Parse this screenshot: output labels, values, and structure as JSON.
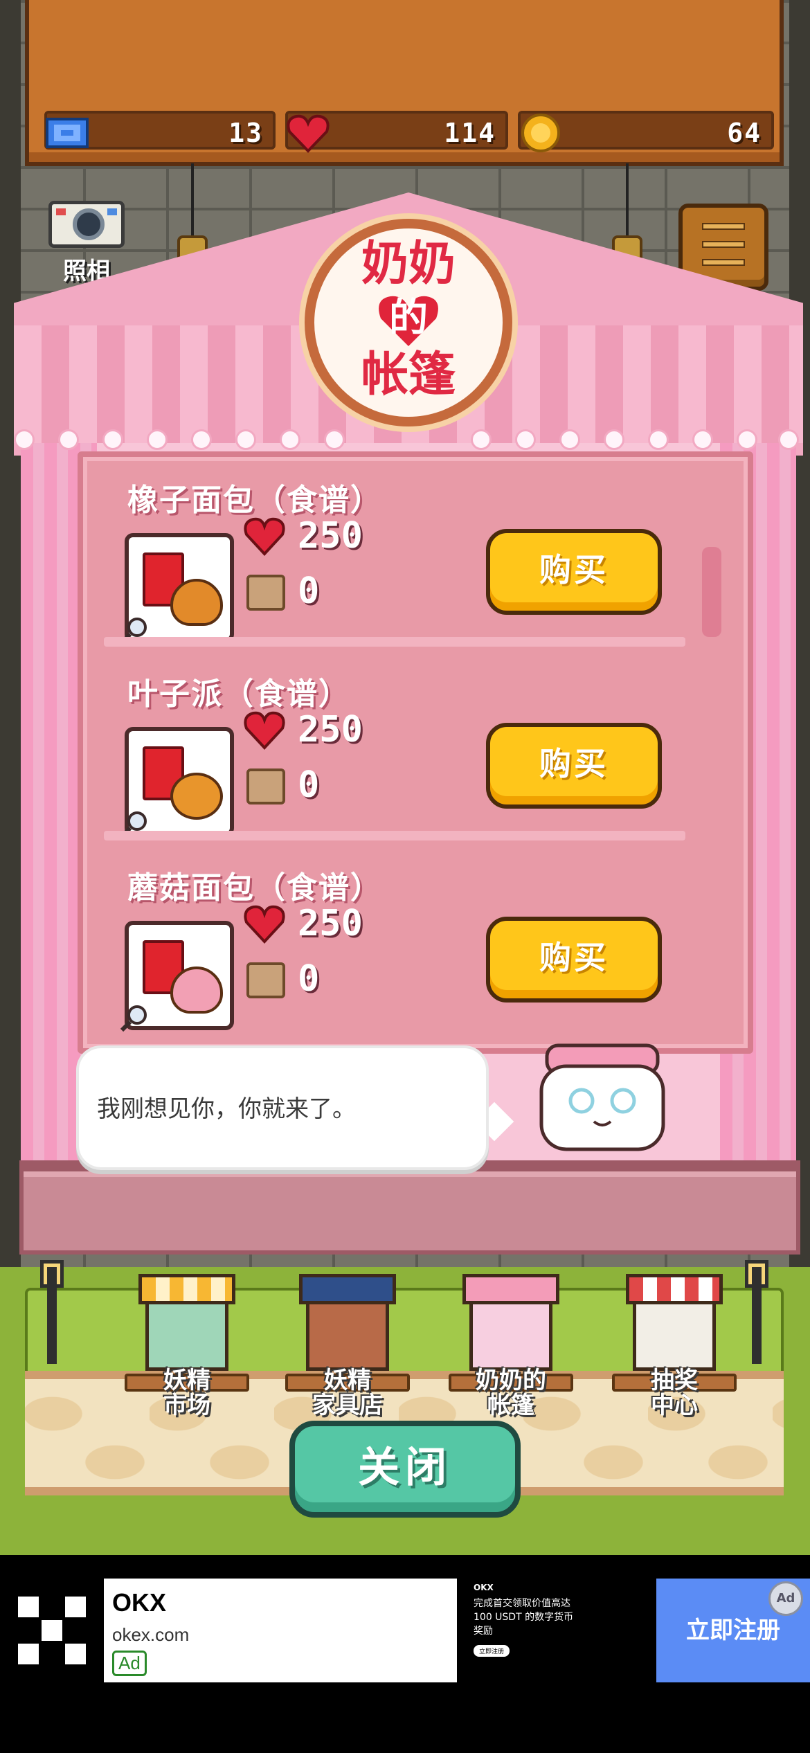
{
  "hud": {
    "tickets": "13",
    "hearts": "114",
    "coins": "64"
  },
  "camera": {
    "label": "照相"
  },
  "sign": {
    "top": "奶奶",
    "middle": "的",
    "bottom": "帐篷"
  },
  "shop": {
    "items": [
      {
        "title": "橡子面包（食谱）",
        "heart_price": "250",
        "box_price": "0",
        "buy_label": "购买",
        "food": "acorn-bread-icon"
      },
      {
        "title": "叶子派（食谱）",
        "heart_price": "250",
        "box_price": "0",
        "buy_label": "购买",
        "food": "leaf-pie-icon"
      },
      {
        "title": "蘑菇面包（食谱）",
        "heart_price": "250",
        "box_price": "0",
        "buy_label": "购买",
        "food": "mushroom-bread-icon"
      }
    ]
  },
  "dialogue": {
    "text": "我刚想见你，你就来了。"
  },
  "buildings": [
    {
      "line1": "妖精",
      "line2": "市场"
    },
    {
      "line1": "妖精",
      "line2": "家具店"
    },
    {
      "line1": "奶奶的",
      "line2": "帐篷"
    },
    {
      "line1": "抽奖",
      "line2": "中心"
    }
  ],
  "close_label": "关闭",
  "ad": {
    "brand": "OKX",
    "url": "okex.com",
    "badge": "Ad",
    "copy_brand": "OKX",
    "copy_text": "完成首交领取价值高达 100 USDT 的数字货币奖励",
    "copy_button": "立即注册",
    "cta": "立即注册",
    "choice": "Ad"
  },
  "colors": {
    "tent_pink": "#f2a9c2",
    "buy_yellow": "#ffc61a",
    "close_teal": "#55c7a5",
    "ad_blue": "#5b8cf5"
  }
}
